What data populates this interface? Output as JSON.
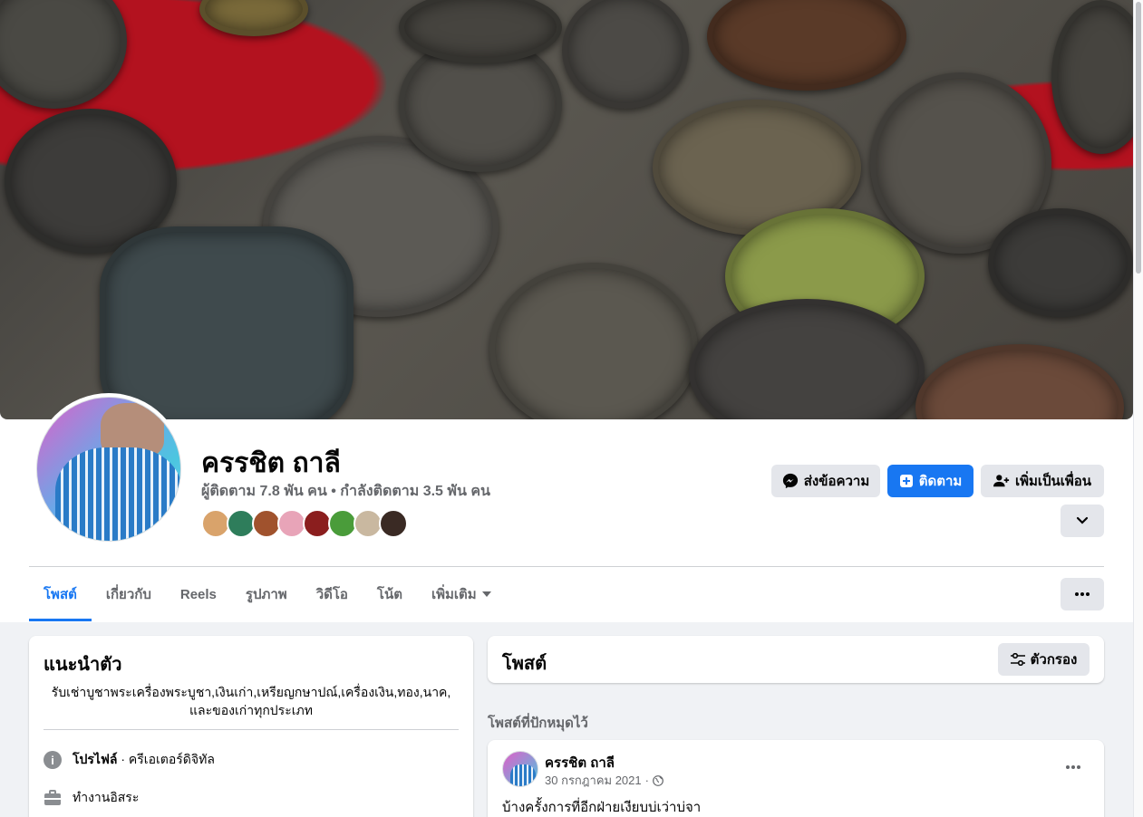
{
  "profile": {
    "name": "ครรชิต ถาลี",
    "stats": "ผู้ติดตาม 7.8 พัน คน • กำลังติดตาม 3.5 พัน คน",
    "friend_colors": [
      "#d9a36b",
      "#2e7d5b",
      "#a0522d",
      "#e8a4b8",
      "#8b1e1e",
      "#4a9c3a",
      "#c9b8a0",
      "#3a2a24"
    ]
  },
  "actions": {
    "message": "ส่งข้อความ",
    "follow": "ติดตาม",
    "add_friend": "เพิ่มเป็นเพื่อน"
  },
  "tabs": [
    {
      "label": "โพสต์"
    },
    {
      "label": "เกี่ยวกับ"
    },
    {
      "label": "Reels"
    },
    {
      "label": "รูปภาพ"
    },
    {
      "label": "วิดีโอ"
    },
    {
      "label": "โน้ต"
    },
    {
      "label": "เพิ่มเติม"
    }
  ],
  "intro": {
    "title": "แนะนำตัว",
    "bio_line1": "รับเช่าบูชาพระเครื่องพระบูชา,เงินเก่า,เหรียญกษาปณ์,เครื่องเงิน,ทอง,นาค,",
    "bio_line2": "และของเก่าทุกประเภท",
    "profile_label": "โปรไฟล์",
    "profile_category": " · ครีเอเตอร์ดิจิทัล",
    "work": "ทำงานอิสระ"
  },
  "posts": {
    "title": "โพสต์",
    "filter": "ตัวกรอง",
    "pinned_label": "โพสต์ที่ปักหมุดไว้",
    "pinned_post": {
      "author": "ครรชิต ถาลี",
      "date": "30 กรกฎาคม 2021",
      "text": "บ้างครั้งการที่อีกฝ่ายเงียบบ่เว่าบ่จา"
    }
  },
  "colors": {
    "accent": "#1877f2",
    "secondary_button": "#e4e6eb",
    "muted_text": "#65676b",
    "page_bg": "#f0f2f5"
  }
}
